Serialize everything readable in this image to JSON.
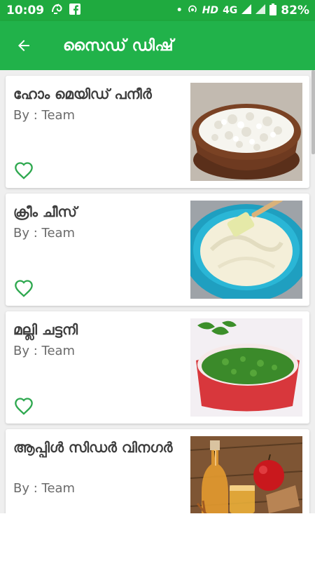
{
  "status_bar": {
    "time": "10:09",
    "network": "HD",
    "signal_type": "4G",
    "battery": "82%"
  },
  "app_bar": {
    "title": "സൈഡ് ഡിഷ്"
  },
  "recipes": [
    {
      "name": "ഹോം മെയിഡ് പനീർ",
      "author": "By : Team",
      "image": "paneer-bowl"
    },
    {
      "name": "ക്രീം ചീസ്",
      "author": "By : Team",
      "image": "cream-cheese-bowl"
    },
    {
      "name": "മല്ലി ചട്ടനി",
      "author": "By : Team",
      "image": "coriander-chutney"
    },
    {
      "name": "ആപ്പിൾ സിഡർ വിനഗർ",
      "author": "By : Team",
      "image": "apple-cider-vinegar"
    }
  ],
  "colors": {
    "status_bar": "#1faa3f",
    "app_bar": "#21b24a",
    "heart": "#2ea84f",
    "background": "#efefef"
  }
}
